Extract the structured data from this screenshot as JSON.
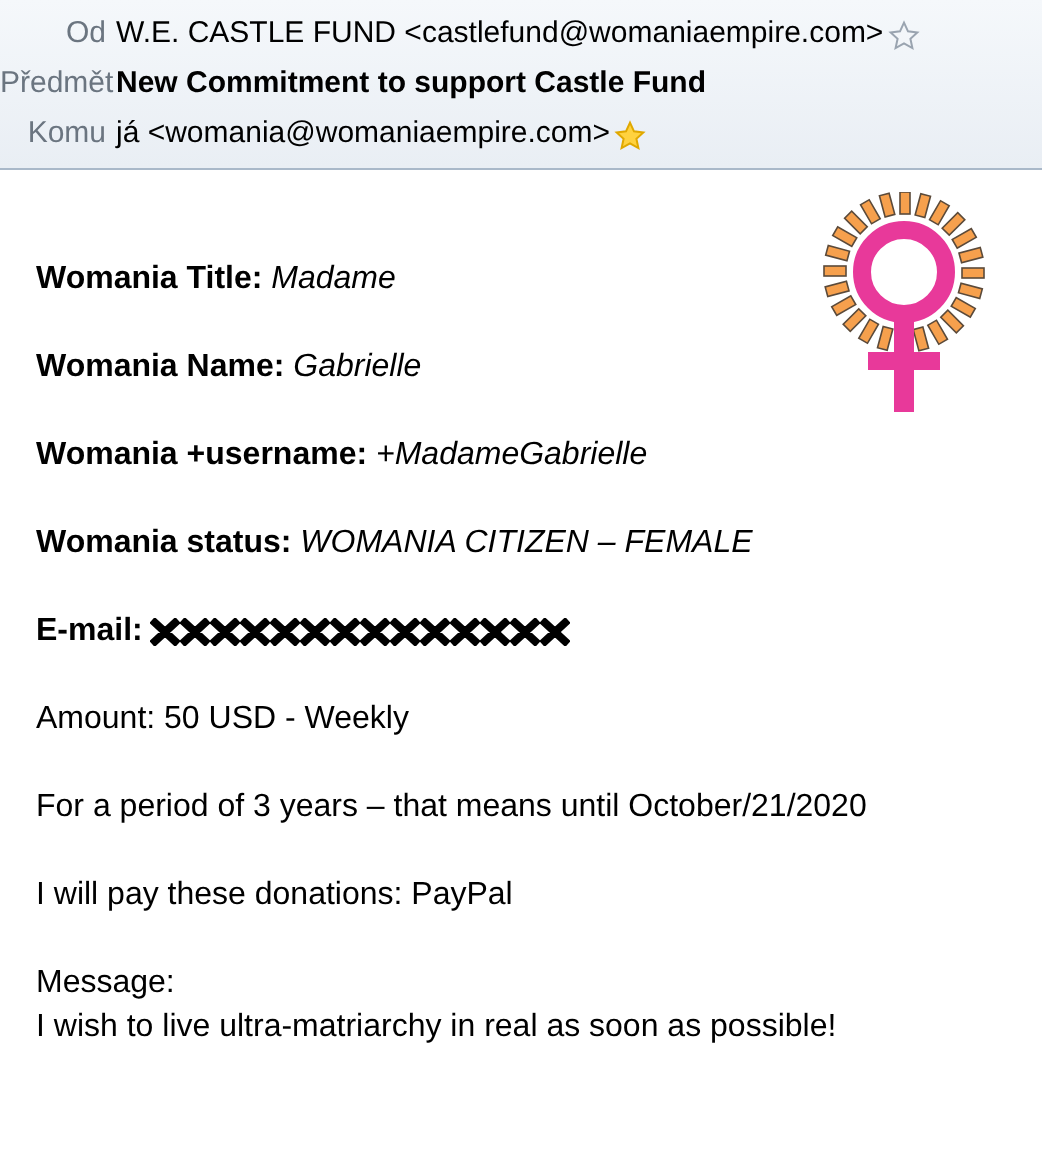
{
  "header": [
    {
      "label": "Od",
      "value": "W.E. CASTLE FUND <castlefund@womaniaempire.com>",
      "bold": false,
      "starred": false
    },
    {
      "label": "Předmět",
      "value": "New Commitment to support Castle Fund",
      "bold": true
    },
    {
      "label": "Komu",
      "value": "já <womania@womaniaempire.com>",
      "bold": false,
      "starred": true
    }
  ],
  "body": [
    {
      "kind": "field",
      "label": "Womania Title:",
      "value": "Madame"
    },
    {
      "kind": "field",
      "label": "Womania Name:",
      "value": "Gabrielle"
    },
    {
      "kind": "field",
      "label": "Womania +username:",
      "value": "+MadameGabrielle"
    },
    {
      "kind": "field",
      "label": "Womania status:",
      "value": "WOMANIA CITIZEN – FEMALE"
    },
    {
      "kind": "redacted",
      "label": "E-mail:"
    },
    {
      "kind": "text",
      "text": "Amount: 50 USD - Weekly"
    },
    {
      "kind": "text",
      "text": "For a period of 3 years – that means until October/21/2020"
    },
    {
      "kind": "text",
      "text": "I will pay these donations: PayPal"
    },
    {
      "kind": "multi",
      "lines": [
        "Message:",
        "I wish to live ultra-matriarchy in real as soon as possible!"
      ]
    }
  ]
}
